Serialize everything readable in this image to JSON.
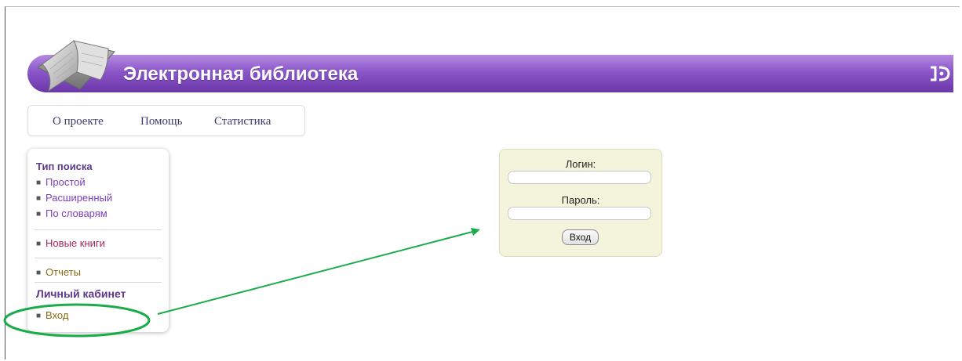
{
  "header": {
    "title": "Электронная библиотека",
    "exit_icon": "exit-icon",
    "logo_icon": "open-book-icon",
    "colors": {
      "banner_top": "#b58ae0",
      "banner_bottom": "#6b38a8"
    }
  },
  "top_menu": {
    "items": [
      {
        "label": "О проекте"
      },
      {
        "label": "Помощь"
      },
      {
        "label": "Статистика"
      }
    ]
  },
  "sidebar": {
    "search_heading": "Тип поиска",
    "search_items": [
      {
        "label": "Простой"
      },
      {
        "label": "Расширенный"
      },
      {
        "label": "По словарям"
      }
    ],
    "new_books": "Новые книги",
    "reports": "Отчеты",
    "account_heading": "Личный кабинет",
    "login_link": "Вход",
    "colors": {
      "search_link": "#7b3fb8",
      "new_books": "#a8255a",
      "reports": "#8a6a10"
    }
  },
  "login_form": {
    "login_label": "Логин:",
    "login_value": "",
    "password_label": "Пароль:",
    "password_value": "",
    "submit_label": "Вход",
    "background": "#f4f4dc"
  },
  "annotation": {
    "highlight_color": "#1aab4a"
  }
}
